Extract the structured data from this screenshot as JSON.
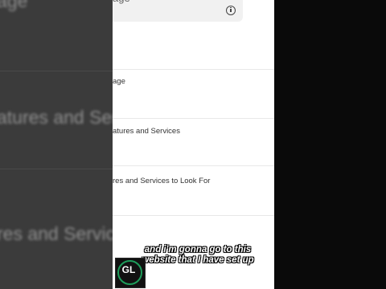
{
  "background_left": {
    "texts": [
      "age",
      "atures and Servi",
      "res and Servic"
    ]
  },
  "panel": {
    "search_text": "age",
    "items": [
      {
        "label": "age"
      },
      {
        "label": "atures and Services"
      },
      {
        "label": "res and Services to Look For"
      }
    ]
  },
  "caption": {
    "line1": "and i'm gonna go to this",
    "line2": "website that I have set up"
  },
  "channel_logo": {
    "text": "GL"
  },
  "colors": {
    "accent": "#1d9c5a",
    "panel_bg": "#ffffff",
    "background": "#3b3b3b"
  },
  "icons": [
    "info-icon"
  ]
}
